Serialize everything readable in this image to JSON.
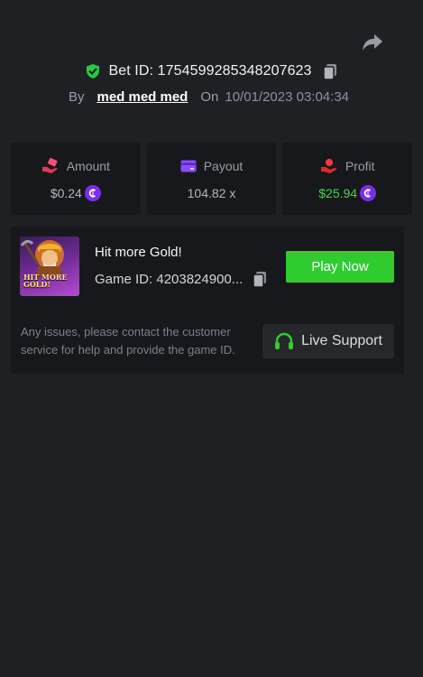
{
  "header": {
    "share_icon": "share-icon",
    "bet_id_label": "Bet ID: 1754599285348207623",
    "verified_icon": "shield-check-icon",
    "copy_icon": "copy-icon",
    "by_label": "By",
    "username": "med med med",
    "on_label": "On",
    "date": "10/01/2023 03:04:34"
  },
  "stats": [
    {
      "icon": "bet-hand-icon",
      "label": "Amount",
      "value": "$0.24",
      "coin": true,
      "color": "#b5b7bd"
    },
    {
      "icon": "card-icon",
      "label": "Payout",
      "value": "104.82 x",
      "coin": false,
      "color": "#b5b7bd"
    },
    {
      "icon": "profit-hand-icon",
      "label": "Profit",
      "value": "$25.94",
      "coin": true,
      "color": "#3fd84c"
    }
  ],
  "game": {
    "thumbnail_caption": "HIT MORE GOLD!",
    "title": "Hit more Gold!",
    "game_id_label": "Game ID: 4203824900...",
    "play_label": "Play Now",
    "help_text": "Any issues, please contact the customer service for help and provide the game ID.",
    "support_label": "Live Support",
    "support_icon": "headset-icon"
  },
  "colors": {
    "background": "#1f2024",
    "card": "#17181b",
    "accent_green": "#2fcc30",
    "profit_green": "#3fd84c",
    "coin_purple": "#7b2cf0"
  }
}
